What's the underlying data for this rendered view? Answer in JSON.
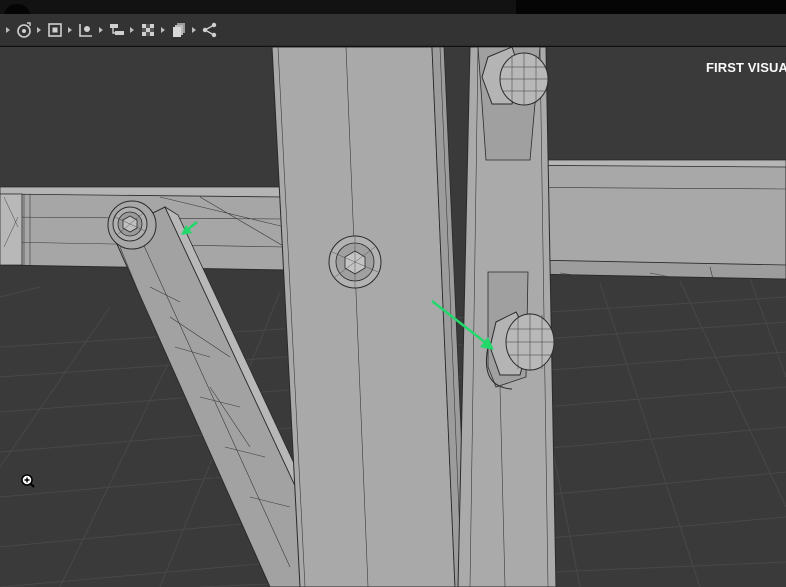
{
  "toolbar": {
    "items": [
      {
        "name": "camera-icon"
      },
      {
        "name": "frame-selection-icon"
      },
      {
        "name": "lighting-icon"
      },
      {
        "name": "hierarchy-icon"
      },
      {
        "name": "shading-checker-icon"
      },
      {
        "name": "layers-icon"
      },
      {
        "name": "share-icon"
      }
    ]
  },
  "viewport": {
    "overlay_label": "FIRST VISUAL",
    "background_color": "#3a3a3a",
    "grid_color": "#474747",
    "model_fill_color": "#a6a6a6",
    "wire_color": "#2a2a2a",
    "annotation_arrow_color": "#22d86a"
  }
}
